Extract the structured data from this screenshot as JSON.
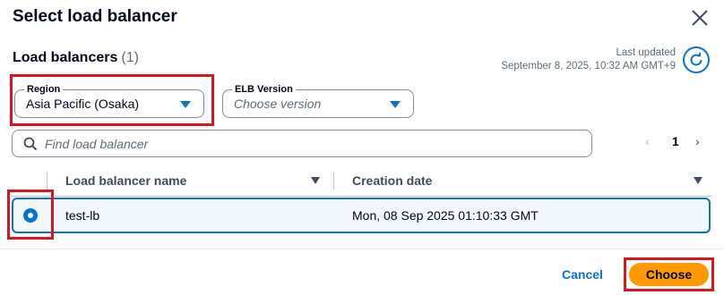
{
  "dialog": {
    "title": "Select load balancer"
  },
  "section": {
    "heading": "Load balancers",
    "count": "(1)",
    "last_updated_label": "Last updated",
    "last_updated_value": "September 8, 2025, 10:32 AM GMT+9"
  },
  "filters": {
    "region_label": "Region",
    "region_value": "Asia Pacific (Osaka)",
    "elb_version_label": "ELB Version",
    "elb_version_placeholder": "Choose version"
  },
  "search": {
    "placeholder": "Find load balancer"
  },
  "pagination": {
    "prev": "‹",
    "current_page": "1",
    "next": "›"
  },
  "table": {
    "columns": [
      "Load balancer name",
      "Creation date"
    ],
    "rows": [
      {
        "selected": true,
        "name": "test-lb",
        "creation_date": "Mon, 08 Sep 2025 01:10:33 GMT"
      }
    ]
  },
  "footer": {
    "cancel_label": "Cancel",
    "choose_label": "Choose"
  },
  "colors": {
    "accent_blue": "#0972d3",
    "primary_button": "#ff9900",
    "highlight_red": "#d9161d",
    "selected_row_bg": "#f2f8fd"
  }
}
